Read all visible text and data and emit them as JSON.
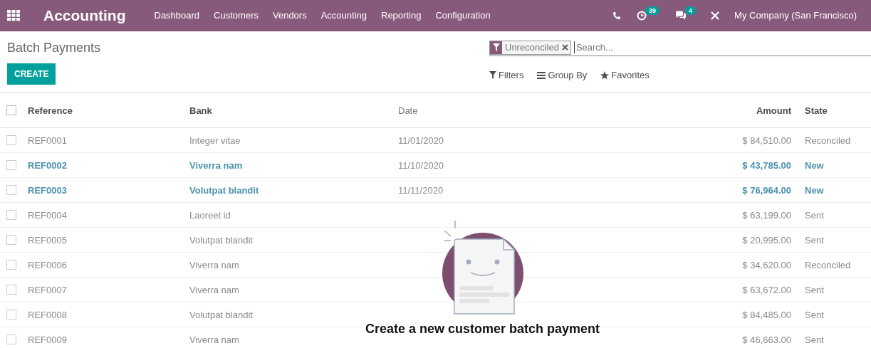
{
  "navbar": {
    "app_title": "Accounting",
    "menu": [
      "Dashboard",
      "Customers",
      "Vendors",
      "Accounting",
      "Reporting",
      "Configuration"
    ],
    "activity_count": "39",
    "message_count": "4",
    "company": "My Company (San Francisco)"
  },
  "control_panel": {
    "breadcrumb": "Batch Payments",
    "create_button": "CREATE",
    "facet": {
      "label": "Unreconciled"
    },
    "search": {
      "placeholder": "Search..."
    },
    "search_options": [
      "Filters",
      "Group By",
      "Favorites"
    ]
  },
  "table": {
    "select_all_checked": false,
    "columns": [
      "Reference",
      "Bank",
      "Date",
      "Amount",
      "State"
    ],
    "rows": [
      {
        "reference": "REF0001",
        "bank": "Integer vitae",
        "date": "11/01/2020",
        "amount": "$ 84,510.00",
        "state": "Reconciled",
        "emphasis": false
      },
      {
        "reference": "REF0002",
        "bank": "Viverra nam",
        "date": "11/10/2020",
        "amount": "$ 43,785.00",
        "state": "New",
        "emphasis": true
      },
      {
        "reference": "REF0003",
        "bank": "Volutpat blandit",
        "date": "11/11/2020",
        "amount": "$ 76,964.00",
        "state": "New",
        "emphasis": true
      },
      {
        "reference": "REF0004",
        "bank": "Laoreet id",
        "amount": "$ 63,199.00",
        "state": "Sent",
        "emphasis": false
      },
      {
        "reference": "REF0005",
        "bank": "Volutpat blandit",
        "amount": "$ 20,995.00",
        "state": "Sent",
        "emphasis": false
      },
      {
        "reference": "REF0006",
        "bank": "Viverra nam",
        "amount": "$ 34,620.00",
        "state": "Reconciled",
        "emphasis": false
      },
      {
        "reference": "REF0007",
        "bank": "Viverra nam",
        "amount": "$ 63,672.00",
        "state": "Sent",
        "emphasis": false
      },
      {
        "reference": "REF0008",
        "bank": "Volutpat blandit",
        "amount": "$ 84,485.00",
        "state": "Sent",
        "emphasis": false
      },
      {
        "reference": "REF0009",
        "bank": "Viverra nam",
        "amount": "$ 46,663.00",
        "state": "Sent",
        "emphasis": false
      }
    ]
  },
  "empty_help": {
    "title": "Create a new customer batch payment"
  }
}
